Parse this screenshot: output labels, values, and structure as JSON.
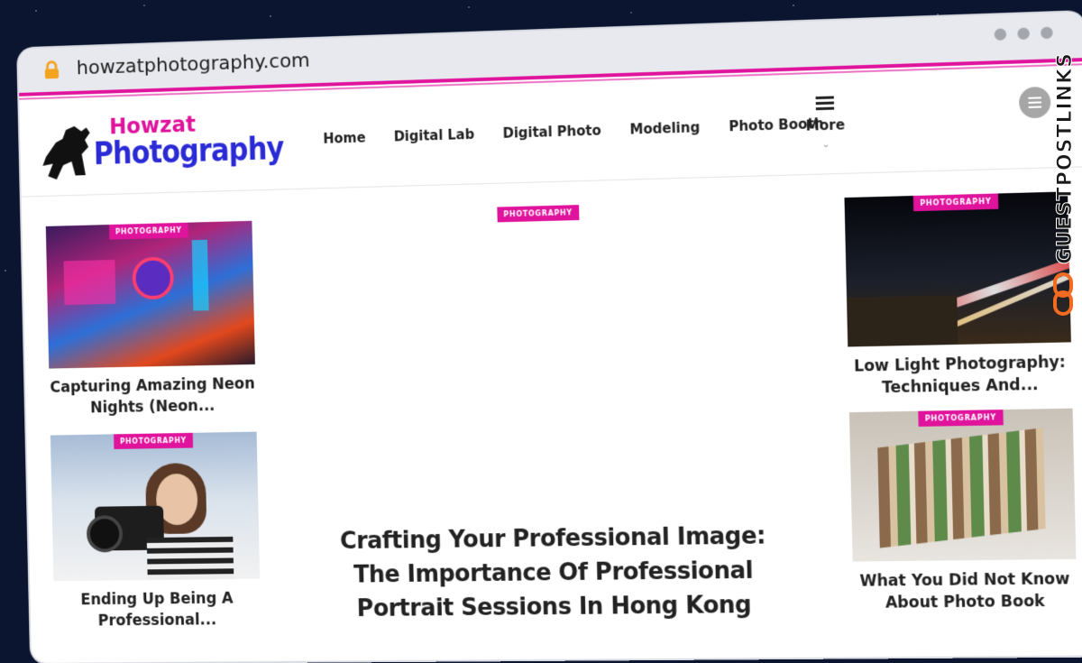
{
  "browser": {
    "url": "howzatphotography.com"
  },
  "site": {
    "logo_top": "Howzat",
    "logo_main": "Photography"
  },
  "nav": {
    "items": [
      "Home",
      "Digital Lab",
      "Digital Photo",
      "Modeling",
      "Photo Booth"
    ],
    "more_label": "More"
  },
  "hero": {
    "badge": "PHOTOGRAPHY",
    "title": "Crafting Your Professional Image: The Importance Of Professional Portrait Sessions In Hong Kong"
  },
  "left_cards": [
    {
      "badge": "PHOTOGRAPHY",
      "title": "Capturing Amazing Neon Nights (Neon..."
    },
    {
      "badge": "PHOTOGRAPHY",
      "title": "Ending Up Being A Professional..."
    }
  ],
  "right_cards": [
    {
      "badge": "PHOTOGRAPHY",
      "title": "Low Light Photography: Techniques And..."
    },
    {
      "badge": "PHOTOGRAPHY",
      "title": "What You Did Not Know About Photo Book"
    }
  ],
  "watermark": {
    "text": "GUESTPOSTLINKS"
  },
  "colors": {
    "accent": "#e0139c",
    "logo_blue": "#2b2bd6",
    "background": "#0b1530"
  },
  "icons": [
    "lock-icon",
    "menu-icon",
    "chevron-down-icon",
    "hamburger-icon",
    "link-icon"
  ]
}
